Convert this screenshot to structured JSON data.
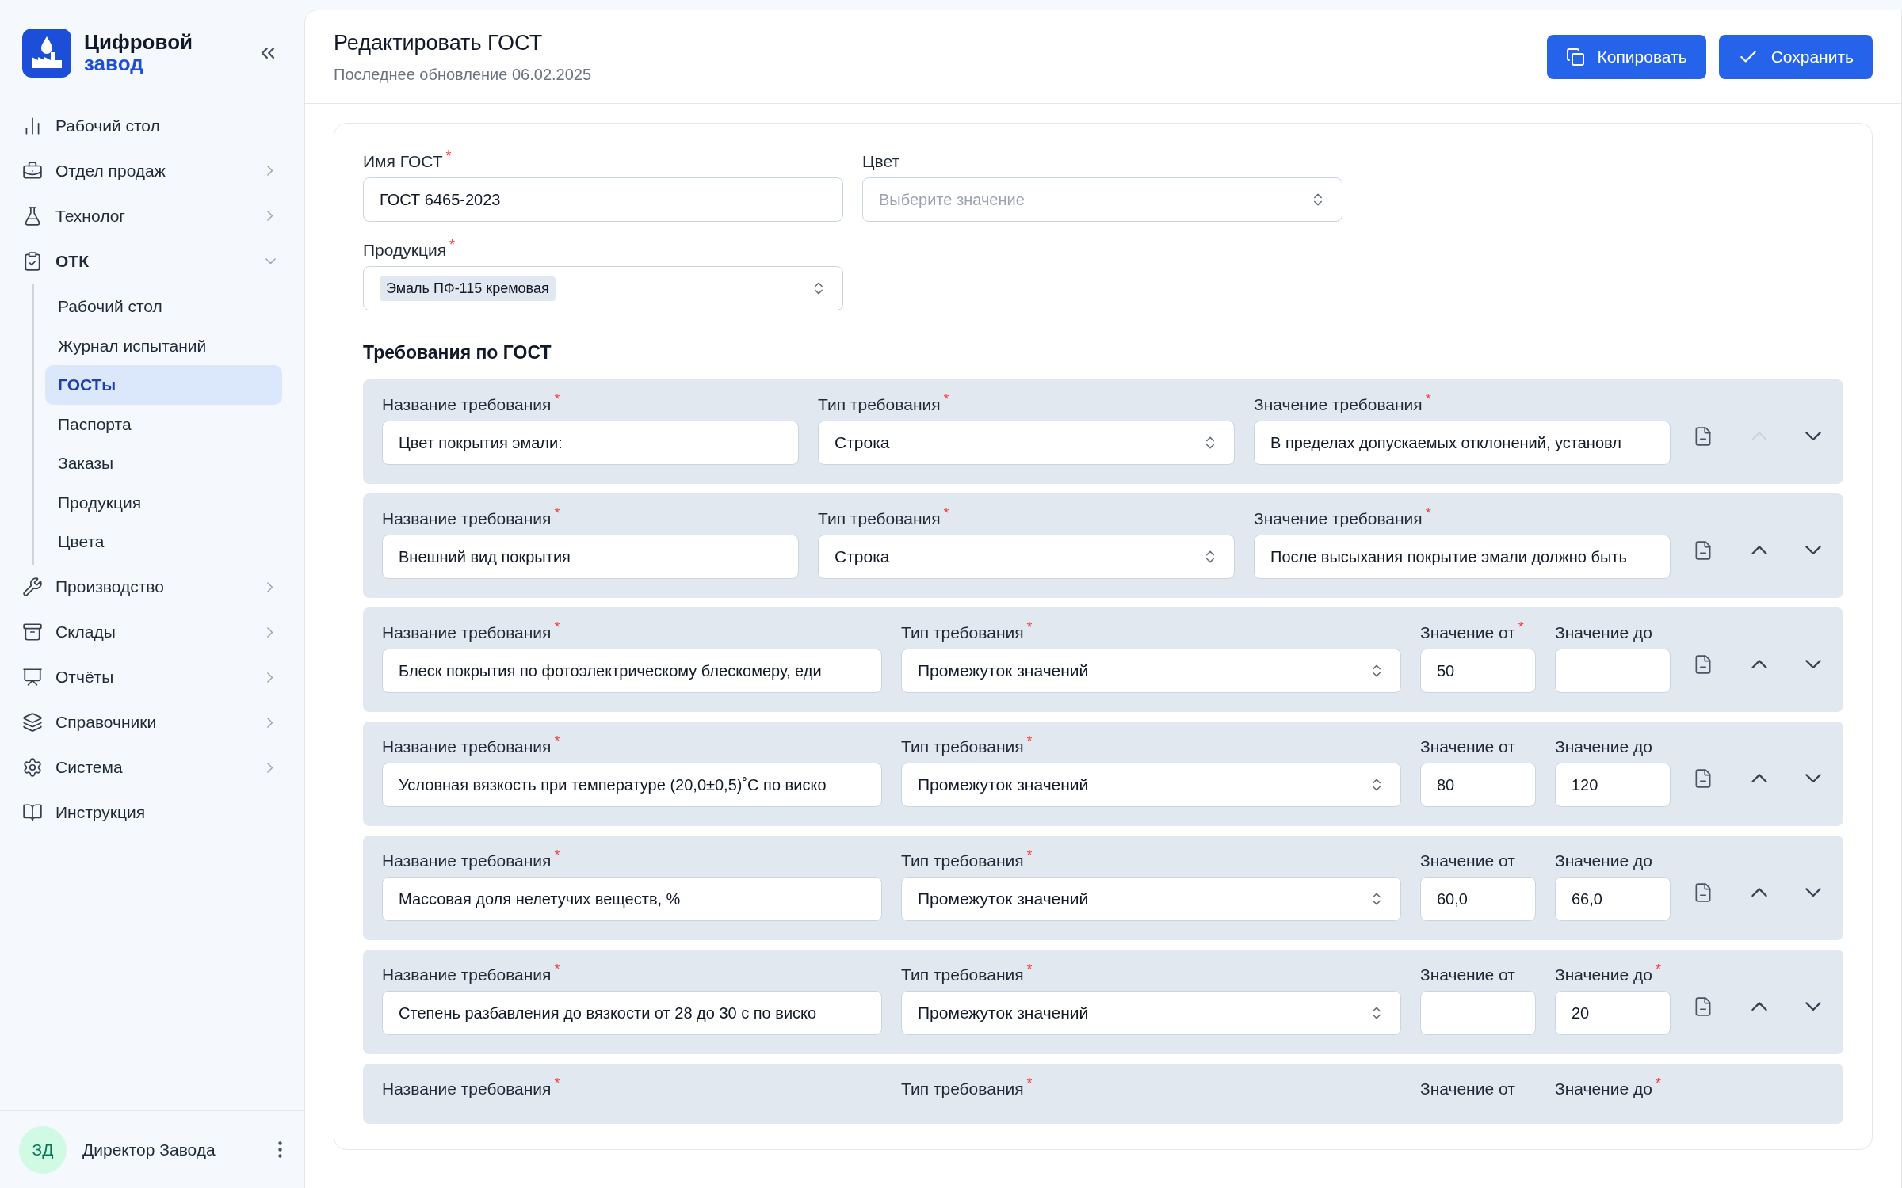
{
  "sidebar": {
    "brand_line_1": "Цифровой",
    "brand_line_2": "завод",
    "items": [
      {
        "label": "Рабочий стол"
      },
      {
        "label": "Отдел продаж",
        "expanded": false
      },
      {
        "label": "Технолог",
        "expanded": false
      },
      {
        "label": "ОТК",
        "expanded": true,
        "children": [
          {
            "label": "Рабочий стол",
            "selected": false
          },
          {
            "label": "Журнал испытаний",
            "selected": false
          },
          {
            "label": "ГОСТы",
            "selected": true
          },
          {
            "label": "Паспорта",
            "selected": false
          },
          {
            "label": "Заказы",
            "selected": false
          },
          {
            "label": "Продукция",
            "selected": false
          },
          {
            "label": "Цвета",
            "selected": false
          }
        ]
      },
      {
        "label": "Производство",
        "expanded": false
      },
      {
        "label": "Склады",
        "expanded": false
      },
      {
        "label": "Отчёты",
        "expanded": false
      },
      {
        "label": "Справочники",
        "expanded": false
      },
      {
        "label": "Система",
        "expanded": false
      },
      {
        "label": "Инструкция"
      }
    ],
    "user": {
      "initials": "ЗД",
      "name": "Директор Завода"
    }
  },
  "header": {
    "title": "Редактировать ГОСТ",
    "subtitle": "Последнее обновление 06.02.2025",
    "buttons": [
      {
        "label": "Копировать",
        "kind": "copy"
      },
      {
        "label": "Сохранить",
        "kind": "save"
      }
    ]
  },
  "form": {
    "name_field": {
      "label": "Имя ГОСТ",
      "required_mark": "*",
      "value": "ГОСТ 6465-2023"
    },
    "color_field": {
      "label": "Цвет",
      "placeholder": "Выберите значение"
    },
    "product_field": {
      "label": "Продукция",
      "required_mark": "*",
      "tag": "Эмаль ПФ-115 кремовая"
    }
  },
  "requirements": {
    "title": "Требования по ГОСТ",
    "rows": [
      {
        "kind": "string",
        "can_move_up": false,
        "fields": [
          {
            "kind": "input",
            "label": "Название требования",
            "required_mark": "*",
            "value": "Цвет покрытия эмали:"
          },
          {
            "kind": "select",
            "label": "Тип требования",
            "required_mark": "*",
            "value": "Строка"
          },
          {
            "kind": "input",
            "label": "Значение требования",
            "required_mark": "*",
            "value": "В пределах допускаемых отклонений, установл"
          }
        ]
      },
      {
        "kind": "string",
        "can_move_up": true,
        "fields": [
          {
            "kind": "input",
            "label": "Название требования",
            "required_mark": "*",
            "value": "Внешний вид покрытия"
          },
          {
            "kind": "select",
            "label": "Тип требования",
            "required_mark": "*",
            "value": "Строка"
          },
          {
            "kind": "input",
            "label": "Значение требования",
            "required_mark": "*",
            "value": "После высыхания покрытие эмали должно быть"
          }
        ]
      },
      {
        "kind": "range",
        "can_move_up": true,
        "fields": [
          {
            "kind": "input",
            "label": "Название требования",
            "required_mark": "*",
            "value": "Блеск покрытия по фотоэлектрическому блескомеру, еди"
          },
          {
            "kind": "select",
            "label": "Тип требования",
            "required_mark": "*",
            "value": "Промежуток значений"
          },
          {
            "kind": "input",
            "label": "Значение от",
            "required_mark": "*",
            "value": "50"
          },
          {
            "kind": "input",
            "label": "Значение до"
          }
        ]
      },
      {
        "kind": "range",
        "can_move_up": true,
        "fields": [
          {
            "kind": "input",
            "label": "Название требования",
            "required_mark": "*",
            "value": "Условная вязкость при температуре (20,0±0,5)˚С по виско"
          },
          {
            "kind": "select",
            "label": "Тип требования",
            "required_mark": "*",
            "value": "Промежуток значений"
          },
          {
            "kind": "input",
            "label": "Значение от",
            "value": "80"
          },
          {
            "kind": "input",
            "label": "Значение до",
            "value": "120"
          }
        ]
      },
      {
        "kind": "range",
        "can_move_up": true,
        "fields": [
          {
            "kind": "input",
            "label": "Название требования",
            "required_mark": "*",
            "value": "Массовая доля нелетучих веществ, %"
          },
          {
            "kind": "select",
            "label": "Тип требования",
            "required_mark": "*",
            "value": "Промежуток значений"
          },
          {
            "kind": "input",
            "label": "Значение от",
            "value": "60,0"
          },
          {
            "kind": "input",
            "label": "Значение до",
            "value": "66,0"
          }
        ]
      },
      {
        "kind": "range",
        "can_move_up": true,
        "fields": [
          {
            "kind": "input",
            "label": "Название требования",
            "required_mark": "*",
            "value": "Степень разбавления до вязкости от 28 до 30 с по виско"
          },
          {
            "kind": "select",
            "label": "Тип требования",
            "required_mark": "*",
            "value": "Промежуток значений"
          },
          {
            "kind": "input",
            "label": "Значение от"
          },
          {
            "kind": "input",
            "label": "Значение до",
            "required_mark": "*",
            "value": "20"
          }
        ]
      },
      {
        "kind": "range",
        "fields": [
          {
            "label": "Название требования",
            "required_mark": "*"
          },
          {
            "label": "Тип требования",
            "required_mark": "*"
          },
          {
            "label": "Значение от"
          },
          {
            "label": "Значение до",
            "required_mark": "*"
          }
        ]
      }
    ]
  }
}
